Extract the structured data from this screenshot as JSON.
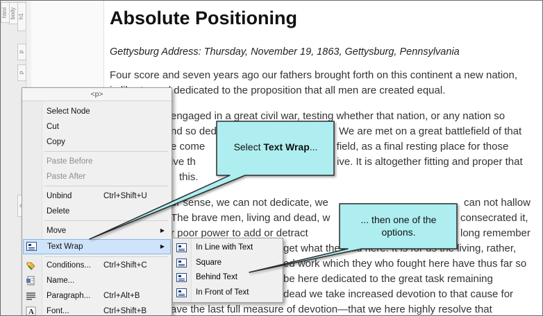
{
  "structure_bar": {
    "tags": [
      "html",
      "body",
      "h1",
      "p",
      "p",
      "p"
    ]
  },
  "document": {
    "title": "Absolute Positioning",
    "subtitle": "Gettysburg Address: Thursday, November 19, 1863, Gettysburg, Pennsylvania",
    "lines": [
      "Four score and seven years ago our fathers brought forth on this continent a new nation,",
      "in liberty, and dedicated to the proposition that all men are created equal.",
      "engaged in a great civil war, testing whether that nation, or any nation so",
      "nd so dedi",
      "We are met on a great battlefield of that",
      "e come",
      "at field, as a final resting place for those",
      "ive th",
      "ive. It is altogether fitting and proper that",
      "this.",
      "er sense, we can not dedicate, we",
      "can not hallow",
      "The brave men, living and dead, w",
      "consecrated it,",
      "r poor power to add or detract",
      "long remember",
      "get what they did here. It is for us the living, rather,",
      "ed work which they who fought here have thus far so",
      "be here dedicated to the great task remaining",
      "dead we take increased devotion to that cause for",
      "ave the last full measure of devotion—that we here highly resolve that"
    ]
  },
  "context_menu": {
    "title": "<p>",
    "items": [
      {
        "label": "Select Node",
        "shortcut": "",
        "disabled": false
      },
      {
        "label": "Cut",
        "shortcut": "",
        "disabled": false
      },
      {
        "label": "Copy",
        "shortcut": "",
        "disabled": false
      },
      {
        "label": "Paste Before",
        "shortcut": "",
        "disabled": true
      },
      {
        "label": "Paste After",
        "shortcut": "",
        "disabled": true
      },
      {
        "label": "Unbind",
        "shortcut": "Ctrl+Shift+U",
        "disabled": false
      },
      {
        "label": "Delete",
        "shortcut": "",
        "disabled": false
      },
      {
        "label": "Move",
        "shortcut": "",
        "disabled": false,
        "submenu_arrow": "▶"
      },
      {
        "label": "Text Wrap",
        "shortcut": "",
        "disabled": false,
        "submenu_arrow": "▶",
        "highlighted": true
      },
      {
        "label": "Conditions...",
        "shortcut": "Ctrl+Shift+C",
        "disabled": false
      },
      {
        "label": "Name...",
        "shortcut": "",
        "disabled": false
      },
      {
        "label": "Paragraph...",
        "shortcut": "Ctrl+Alt+B",
        "disabled": false
      },
      {
        "label": "Font...",
        "shortcut": "Ctrl+Shift+B",
        "disabled": false
      }
    ]
  },
  "submenu": {
    "items": [
      "In Line with Text",
      "Square",
      "Behind Text",
      "In Front of Text"
    ]
  },
  "callouts": {
    "first": {
      "prefix": "Select ",
      "bold": "Text Wrap",
      "suffix": "..."
    },
    "second": {
      "line1": "... then one of the",
      "line2": "options."
    }
  },
  "colors": {
    "callout_fill": "#aeeef0",
    "callout_border": "#2b2b2b",
    "highlight": "#cfe4fa",
    "highlight_border": "#86b6e8"
  },
  "icons": {
    "text_wrap": "text-wrap-icon",
    "conditions": "tag-icon",
    "name": "name-icon",
    "paragraph": "paragraph-icon",
    "font": "font-icon"
  }
}
